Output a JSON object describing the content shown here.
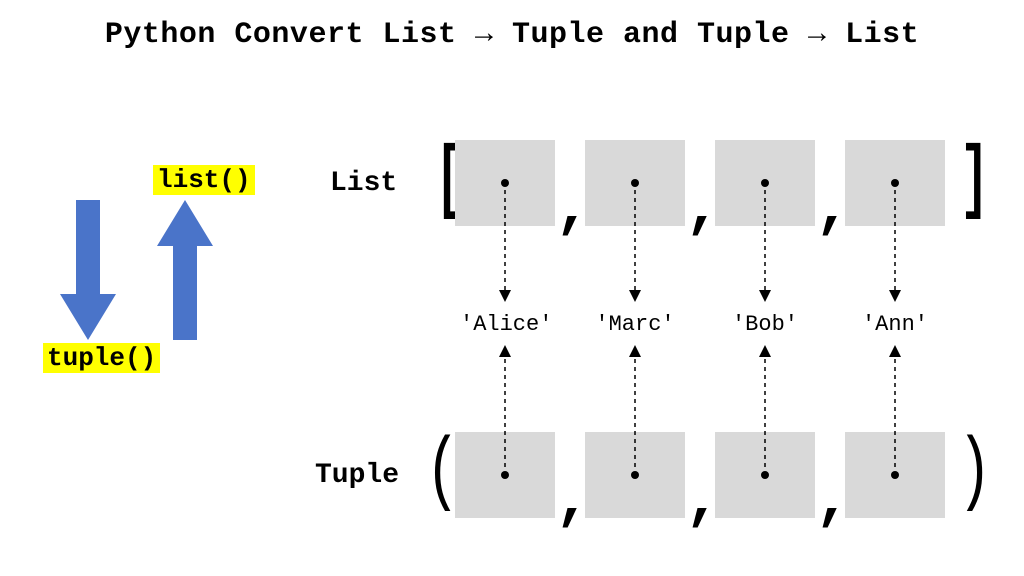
{
  "title_parts": {
    "p1": "Python Convert List ",
    "arrow": "→",
    "p2": " Tuple and Tuple ",
    "p3": " List"
  },
  "functions": {
    "to_list": "list()",
    "to_tuple": "tuple()"
  },
  "labels": {
    "list": "List",
    "tuple": "Tuple"
  },
  "values": [
    "'Alice'",
    "'Marc'",
    "'Bob'",
    "'Ann'"
  ],
  "symbols": {
    "open_bracket": "[",
    "close_bracket": "]",
    "open_paren": "(",
    "close_paren": ")",
    "comma": ","
  },
  "colors": {
    "highlight": "#ffff00",
    "arrow": "#4a74c9",
    "cell": "#d9d9d9"
  }
}
